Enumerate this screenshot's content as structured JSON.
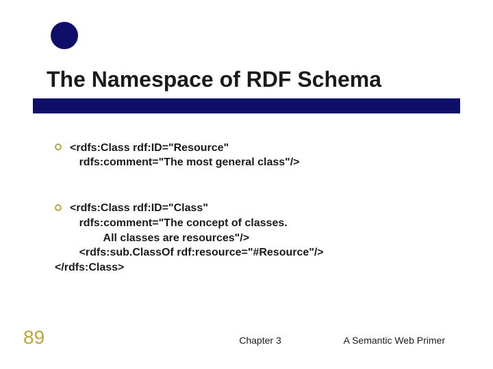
{
  "title": "The Namespace of RDF Schema",
  "block1": {
    "line1": "<rdfs:Class rdf:ID=\"Resource\"",
    "line2": "        rdfs:comment=\"The most general class\"/>"
  },
  "block2": {
    "line1": "<rdfs:Class rdf:ID=\"Class\"",
    "line2": "        rdfs:comment=\"The concept of classes.",
    "line3": "                All classes are resources\"/>",
    "line4": "        <rdfs:sub.ClassOf rdf:resource=\"#Resource\"/>",
    "line5": "</rdfs:Class>"
  },
  "slideNumber": "89",
  "footerCenter": "Chapter 3",
  "footerRight": "A Semantic Web Primer"
}
